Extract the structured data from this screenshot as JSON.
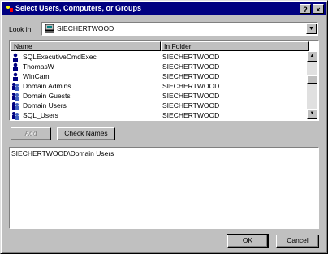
{
  "window": {
    "title": "Select Users, Computers, or Groups",
    "help_label": "?",
    "close_label": "×"
  },
  "lookin": {
    "label": "Look in:",
    "value": "SIECHERTWOOD",
    "dropdown_glyph": "▼"
  },
  "list": {
    "columns": {
      "name": "Name",
      "folder": "In Folder"
    },
    "rows": [
      {
        "name": "SQLExecutiveCmdExec",
        "folder": "SIECHERTWOOD",
        "icon": "user-icon"
      },
      {
        "name": "ThomasW",
        "folder": "SIECHERTWOOD",
        "icon": "user-icon"
      },
      {
        "name": "WinCam",
        "folder": "SIECHERTWOOD",
        "icon": "user-icon"
      },
      {
        "name": "Domain Admins",
        "folder": "SIECHERTWOOD",
        "icon": "group-icon"
      },
      {
        "name": "Domain Guests",
        "folder": "SIECHERTWOOD",
        "icon": "group-icon"
      },
      {
        "name": "Domain Users",
        "folder": "SIECHERTWOOD",
        "icon": "group-icon"
      },
      {
        "name": "SQL_Users",
        "folder": "SIECHERTWOOD",
        "icon": "group-icon"
      }
    ],
    "scroll": {
      "up_glyph": "▲",
      "down_glyph": "▼"
    }
  },
  "buttons": {
    "add": "Add",
    "check_names": "Check Names",
    "ok": "OK",
    "cancel": "Cancel"
  },
  "selected": {
    "text": "SIECHERTWOOD\\Domain Users"
  },
  "colors": {
    "titlebar": "#000080",
    "face": "#c0c0c0"
  }
}
